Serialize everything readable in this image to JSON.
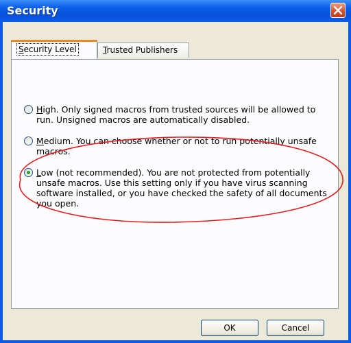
{
  "window": {
    "title": "Security"
  },
  "tabs": [
    {
      "label_pre": "",
      "label_key": "S",
      "label_post": "ecurity Level",
      "active": true
    },
    {
      "label_pre": "",
      "label_key": "T",
      "label_post": "rusted Publishers",
      "active": false
    }
  ],
  "options": [
    {
      "key": "H",
      "text_after_key": "igh. Only signed macros from trusted sources will be allowed to",
      "line2": "run. Unsigned macros are automatically disabled.",
      "checked": false
    },
    {
      "key": "M",
      "text_after_key": "edium. You can choose whether or not to run potentially unsafe",
      "line2": "macros.",
      "checked": false
    },
    {
      "key": "L",
      "text_after_key": "ow (not recommended). You are not protected from potentially",
      "line2": "unsafe macros. Use this setting only if you have virus scanning",
      "line3": "software installed, or you have checked the safety of all documents",
      "line4": "you open.",
      "checked": true
    }
  ],
  "buttons": {
    "ok": "OK",
    "cancel": "Cancel"
  },
  "colors": {
    "annotation_circle": "#e41c1c",
    "title_bar": "#0a5ee9",
    "dialog_bg": "#ece9d8"
  }
}
